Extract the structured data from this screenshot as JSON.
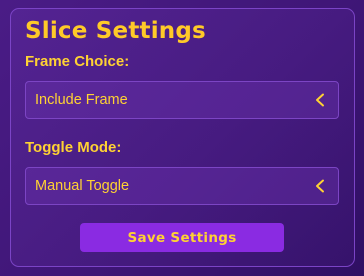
{
  "panel": {
    "title": "Slice Settings"
  },
  "frame_choice": {
    "label": "Frame Choice:",
    "selected": "Include Frame",
    "icon": "chevron-left-icon"
  },
  "toggle_mode": {
    "label": "Toggle Mode:",
    "selected": "Manual Toggle",
    "icon": "chevron-left-icon"
  },
  "actions": {
    "save_label": "Save Settings"
  },
  "colors": {
    "background": "#3f1677",
    "accent_text": "#ffd233",
    "title": "#ffca28",
    "button": "#8a2be2",
    "border": "#7b44c6"
  }
}
